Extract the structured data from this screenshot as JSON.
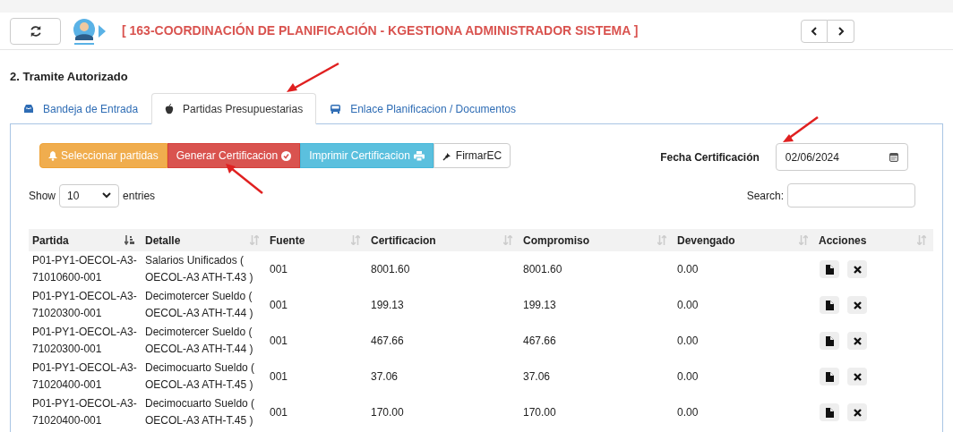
{
  "header": {
    "title": "[ 163-COORDINACIÓN DE PLANIFICACIÓN - KGESTIONA ADMINISTRADOR SISTEMA ]"
  },
  "section_title": "2. Tramite Autorizado",
  "tabs": [
    {
      "label": "Bandeja de Entrada",
      "kind": "inbox",
      "selected": false
    },
    {
      "label": "Partidas Presupuestarias",
      "kind": "apple",
      "selected": true
    },
    {
      "label": "Enlace Planificacion / Documentos",
      "kind": "bus",
      "selected": false
    }
  ],
  "toolbar": [
    {
      "label": "Seleccionar partidas",
      "kind": "warning"
    },
    {
      "label": "Generar Certificacion",
      "kind": "danger"
    },
    {
      "label": "Imprimir Certificacion",
      "kind": "info"
    },
    {
      "label": "FirmarEC",
      "kind": "default"
    }
  ],
  "date_field": {
    "label": "Fecha Certificación",
    "value": "02/06/2024"
  },
  "length": {
    "before": "Show",
    "value": "10",
    "after": "entries"
  },
  "search": {
    "label": "Search:"
  },
  "table": {
    "columns": [
      {
        "label": "Partida",
        "sorted": true
      },
      {
        "label": "Detalle",
        "sorted": false
      },
      {
        "label": "Fuente",
        "sorted": false
      },
      {
        "label": "Certificacion",
        "sorted": false
      },
      {
        "label": "Compromiso",
        "sorted": false
      },
      {
        "label": "Devengado",
        "sorted": false
      },
      {
        "label": "Acciones",
        "sorted": false
      }
    ],
    "rows": [
      [
        "P01-PY1-OECOL-A3-71010600-001",
        "Salarios Unificados ( OECOL-A3 ATH-T.43 )",
        "001",
        "8001.60",
        "8001.60",
        "0.00"
      ],
      [
        "P01-PY1-OECOL-A3-71020300-001",
        "Decimotercer Sueldo ( OECOL-A3 ATH-T.44 )",
        "001",
        "199.13",
        "199.13",
        "0.00"
      ],
      [
        "P01-PY1-OECOL-A3-71020300-001",
        "Decimotercer Sueldo ( OECOL-A3 ATH-T.44 )",
        "001",
        "467.66",
        "467.66",
        "0.00"
      ],
      [
        "P01-PY1-OECOL-A3-71020400-001",
        "Decimocuarto Sueldo ( OECOL-A3 ATH-T.45 )",
        "001",
        "37.06",
        "37.06",
        "0.00"
      ],
      [
        "P01-PY1-OECOL-A3-71020400-001",
        "Decimocuarto Sueldo ( OECOL-A3 ATH-T.45 )",
        "001",
        "170.00",
        "170.00",
        "0.00"
      ]
    ]
  }
}
